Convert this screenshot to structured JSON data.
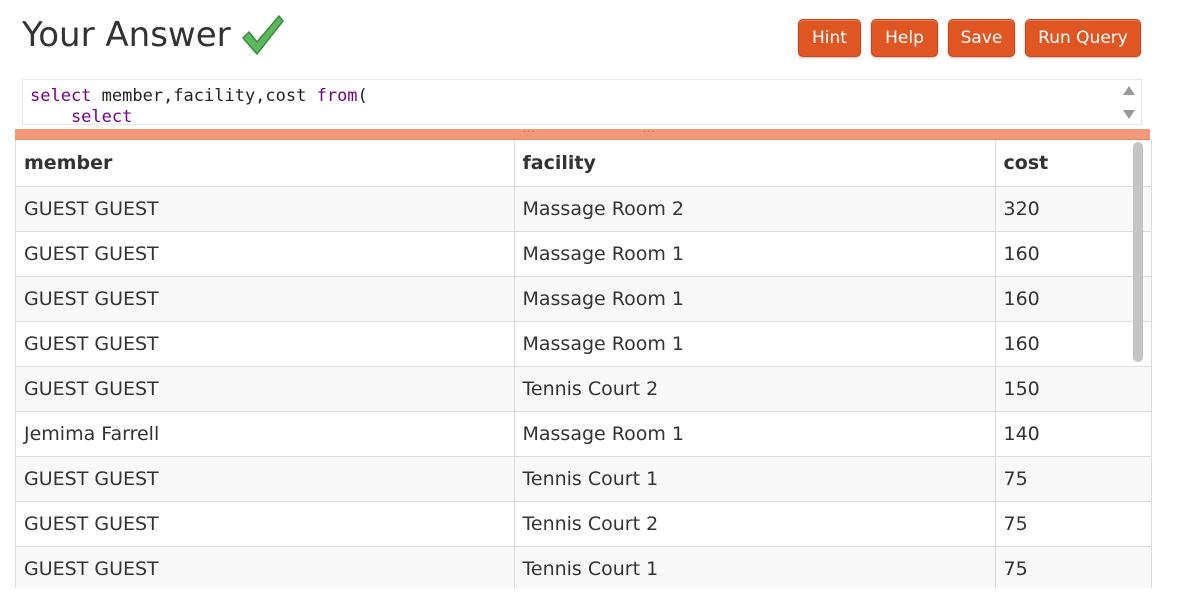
{
  "header": {
    "title": "Your Answer",
    "check_color": "#5cb85c"
  },
  "toolbar": {
    "hint_label": "Hint",
    "help_label": "Help",
    "save_label": "Save",
    "run_label": "Run Query",
    "button_color": "#e05623"
  },
  "editor": {
    "lines": [
      [
        {
          "t": "select",
          "k": true
        },
        {
          "t": " member,facility,cost ",
          "k": false
        },
        {
          "t": "from",
          "k": true
        },
        {
          "t": "(",
          "k": false
        }
      ],
      [
        {
          "t": "    select",
          "k": true
        }
      ]
    ]
  },
  "results": {
    "columns": [
      "member",
      "facility",
      "cost"
    ],
    "rows": [
      [
        "GUEST GUEST",
        "Massage Room 2",
        "320"
      ],
      [
        "GUEST GUEST",
        "Massage Room 1",
        "160"
      ],
      [
        "GUEST GUEST",
        "Massage Room 1",
        "160"
      ],
      [
        "GUEST GUEST",
        "Massage Room 1",
        "160"
      ],
      [
        "GUEST GUEST",
        "Tennis Court 2",
        "150"
      ],
      [
        "Jemima Farrell",
        "Massage Room 1",
        "140"
      ],
      [
        "GUEST GUEST",
        "Tennis Court 1",
        "75"
      ],
      [
        "GUEST GUEST",
        "Tennis Court 2",
        "75"
      ],
      [
        "GUEST GUEST",
        "Tennis Court 1",
        "75"
      ]
    ]
  }
}
